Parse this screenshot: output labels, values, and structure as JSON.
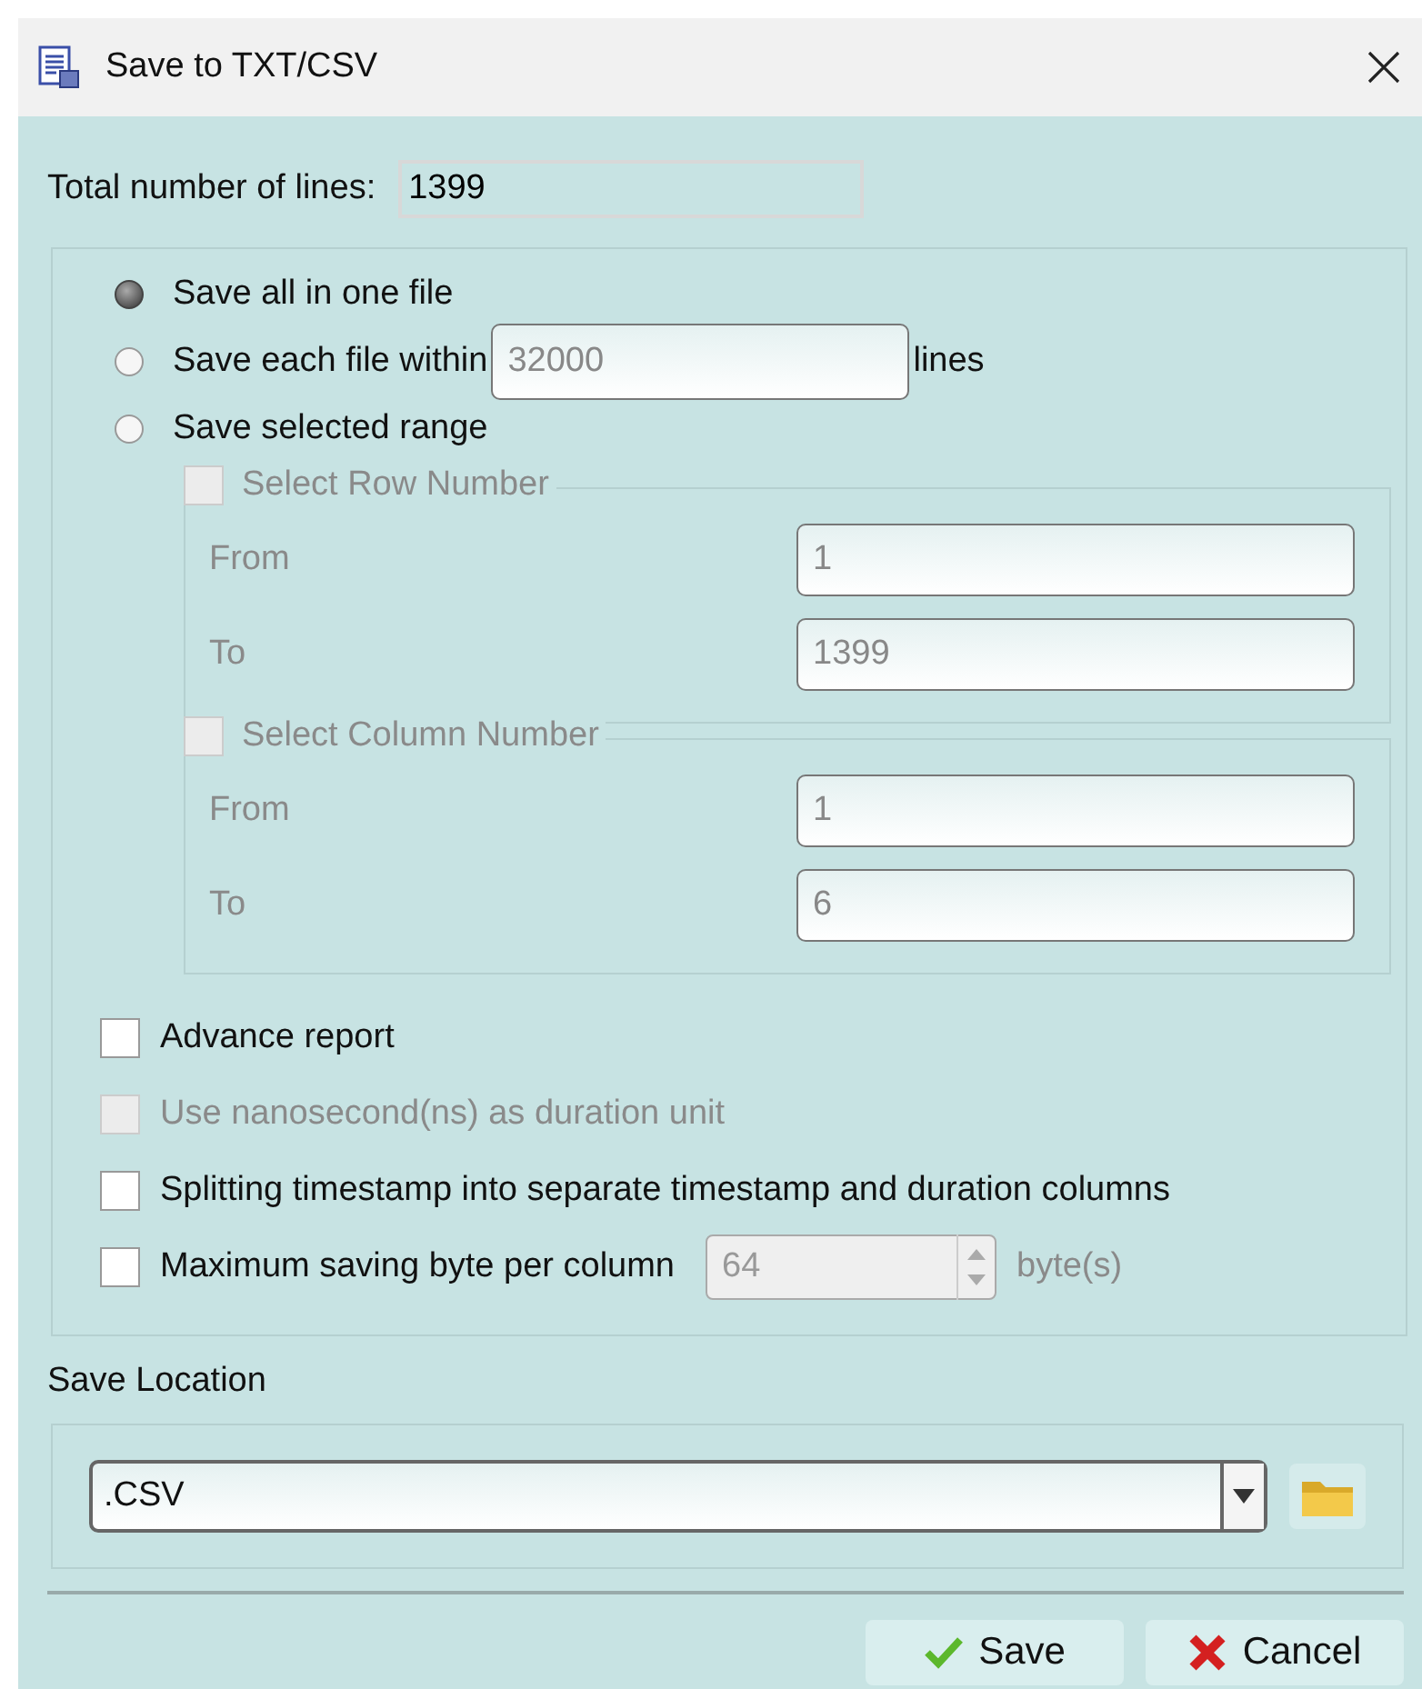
{
  "window": {
    "title": "Save to TXT/CSV"
  },
  "total_lines": {
    "label": "Total number of lines:",
    "value": "1399"
  },
  "save_modes": [
    {
      "kind": "plain",
      "label": "Save all in one file",
      "selected": true
    },
    {
      "kind": "count",
      "label": "Save each file within",
      "value": "32000",
      "suffix": "lines",
      "selected": false
    },
    {
      "kind": "plain",
      "label": "Save selected range",
      "selected": false
    }
  ],
  "ranges": [
    {
      "label": "Select Row Number",
      "checked": false,
      "disabled": true,
      "fields": [
        {
          "label": "From",
          "value": "1"
        },
        {
          "label": "To",
          "value": "1399"
        }
      ]
    },
    {
      "label": "Select Column Number",
      "checked": false,
      "disabled": true,
      "fields": [
        {
          "label": "From",
          "value": "1"
        },
        {
          "label": "To",
          "value": "6"
        }
      ]
    }
  ],
  "options": [
    {
      "kind": "plain",
      "label": "Advance report",
      "checked": false,
      "disabled": false
    },
    {
      "kind": "plain",
      "label": "Use nanosecond(ns) as duration unit",
      "checked": false,
      "disabled": true
    },
    {
      "kind": "plain",
      "label": "Splitting timestamp into separate timestamp and duration columns",
      "checked": false,
      "disabled": false
    },
    {
      "kind": "spinner",
      "label": "Maximum saving byte per column",
      "value": "64",
      "unit": "byte(s)",
      "checked": false,
      "disabled": false
    }
  ],
  "save_location": {
    "label": "Save Location",
    "value": ".CSV"
  },
  "buttons": [
    {
      "kind": "save",
      "label": "Save"
    },
    {
      "kind": "cancel",
      "label": "Cancel"
    }
  ]
}
